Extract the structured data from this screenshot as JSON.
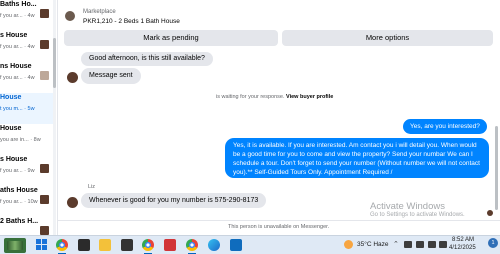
{
  "conversations": [
    {
      "name": "Baths Ho...",
      "preview": "f you ar...",
      "time": "4w",
      "thumb": "dark"
    },
    {
      "name": "s House",
      "preview": "f you ar...",
      "time": "4w",
      "thumb": "dark"
    },
    {
      "name": "ns House",
      "preview": "f you ar...",
      "time": "4w",
      "thumb": "light"
    },
    {
      "name": "House",
      "preview": "t you m...",
      "time": "5w",
      "thumb": "none"
    },
    {
      "name": "House",
      "preview": "you are in...",
      "time": "8w",
      "thumb": "none"
    },
    {
      "name": "s House",
      "preview": "f you ar...",
      "time": "9w",
      "thumb": "dark"
    },
    {
      "name": "aths House",
      "preview": "f you ar...",
      "time": "10w",
      "thumb": "dark"
    },
    {
      "name": "2 Baths H...",
      "preview": "",
      "time": "",
      "thumb": "dark"
    }
  ],
  "header": {
    "label": "Marketplace",
    "title": "PKR1,210 - 2 Beds 1 Bath House",
    "buttons": {
      "pending": "Mark as pending",
      "options": "More options"
    }
  },
  "messages": {
    "m1": "Good afternoon, is this still available?",
    "m2": "Message sent",
    "waiting": "is waiting for your response.",
    "waiting_link": "View buyer profile",
    "m3": "Yes, are you interested?",
    "m4": "Yes, it is available. If you are interested.  Am contact you i will detail you.  When would be a good time for you to come and view the property? Send your numbar We can I schedule a tour.  Don't forget to send your number (Without number we will not contact you).** Self-Guided Tours Only. Appointment Required /",
    "sender": "Liz",
    "m5": "Whenever is good for you my number is 575-290-8173"
  },
  "footer": {
    "unavailable": "This person is unavailable on Messenger.",
    "activate_title": "Activate Windows",
    "activate_sub": "Go to Settings to activate Windows."
  },
  "taskbar": {
    "weather_temp": "35°C  Haze",
    "time": "8:52 AM",
    "date": "4/12/2025",
    "notifications": "1"
  }
}
